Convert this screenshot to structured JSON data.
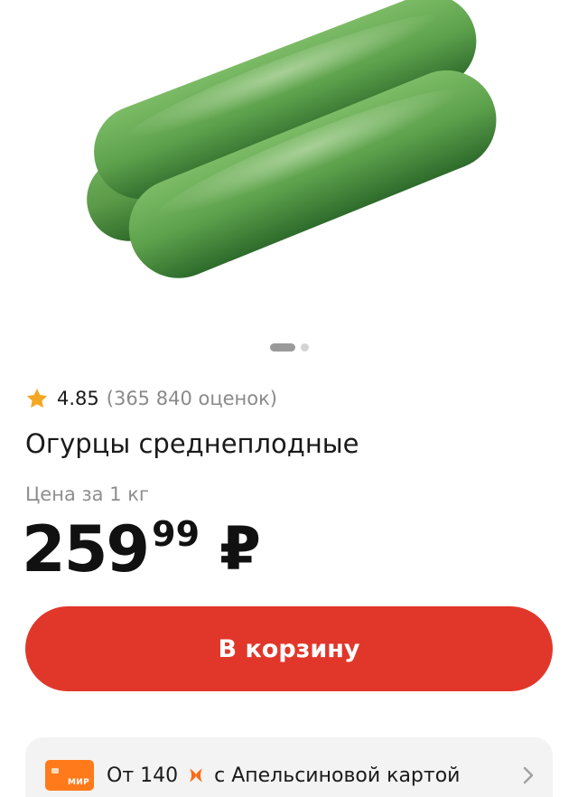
{
  "gallery": {
    "image_alt": "cucumber-product-photo",
    "slide_count": 2,
    "active_slide": 1
  },
  "rating": {
    "score": "4.85",
    "reviews": "(365 840 оценок)",
    "icon": "star-icon",
    "star_color": "#f5a623"
  },
  "product": {
    "title": "Огурцы среднеплодные",
    "unit_label": "Цена за 1 кг"
  },
  "price": {
    "main": "259",
    "cents": "99",
    "currency": "₽"
  },
  "cart_button": {
    "label": "В корзину",
    "color": "#e1372b"
  },
  "promo": {
    "card_label": "МИР",
    "card_icon": "card-icon",
    "card_color": "#ff7a1a",
    "amount": "От 140",
    "bonus_icon": "bonus-x-icon",
    "text": "с Апельсиновой картой",
    "chevron": "chevron-right-icon"
  }
}
